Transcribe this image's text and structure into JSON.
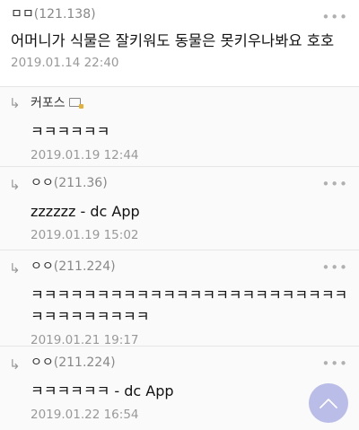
{
  "comments": [
    {
      "author": "ㅁㅁ",
      "ip": "(121.138)",
      "text": "어머니가 식물은 잘키워도 동물은 못키우나봐요 호호",
      "date": "2019.01.14 22:40"
    },
    {
      "author": "커포스",
      "ip": "",
      "text": "ㅋㅋㅋㅋㅋㅋ",
      "date": "2019.01.19 12:44"
    },
    {
      "author": "ㅇㅇ",
      "ip": "(211.36)",
      "text": "zzzzzz - dc App",
      "date": "2019.01.19 15:02"
    },
    {
      "author": "ㅇㅇ",
      "ip": "(211.224)",
      "text": "ㅋㅋㅋㅋㅋㅋㅋㅋㅋㅋㅋㅋㅋㅋㅋㅋㅋㅋㅋㅋㅋㅋㅋㅋㅋㅋㅋㅋㅋㅋㅋㅋㅋ",
      "date": "2019.01.21 19:17"
    },
    {
      "author": "ㅇㅇ",
      "ip": "(211.224)",
      "text": "ㅋㅋㅋㅋㅋㅋ - dc App",
      "date": "2019.01.22 16:54"
    }
  ],
  "icons": {
    "reply": "reply-arrow-icon",
    "more": "more-dots-icon",
    "badge": "lock-icon",
    "scroll_top": "chevron-up-icon"
  },
  "colors": {
    "scroll_button": "#b9bde8",
    "date_text": "#999999",
    "reply_background": "#fafafa"
  }
}
